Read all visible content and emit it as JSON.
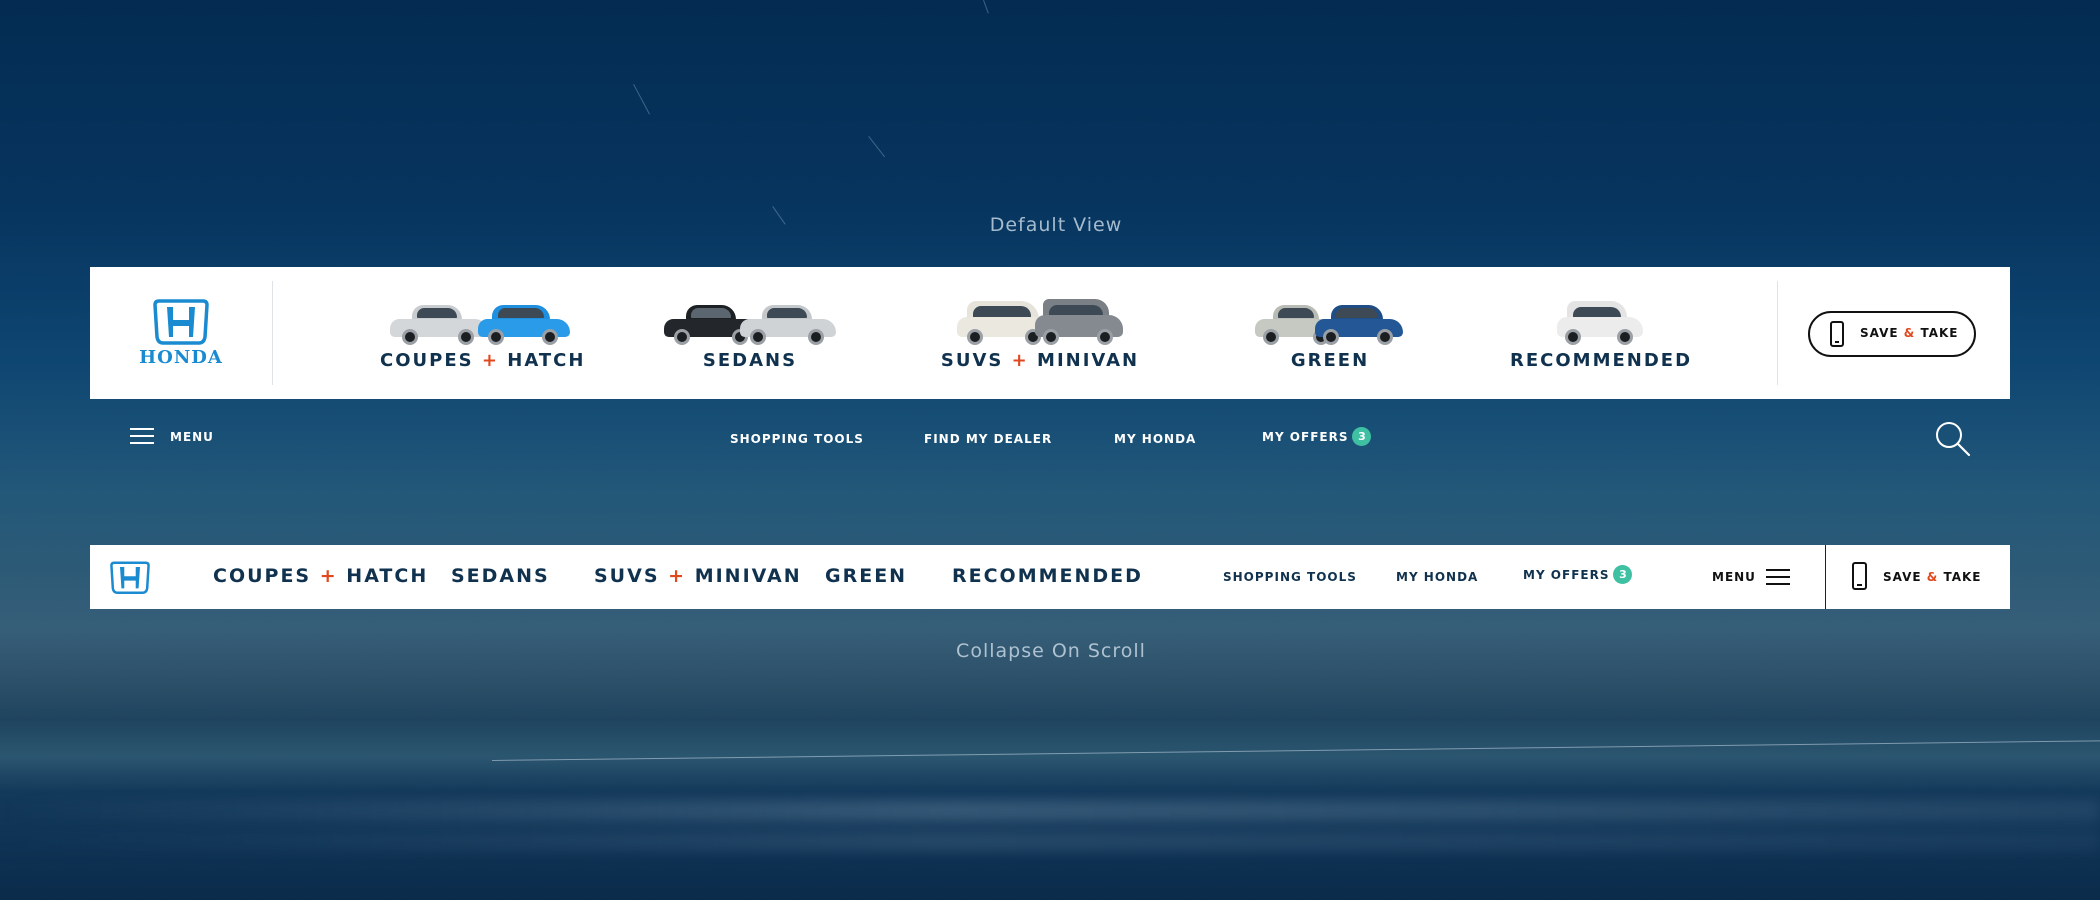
{
  "captions": {
    "default_view": "Default View",
    "collapse_on_scroll": "Collapse On Scroll"
  },
  "brand": {
    "logo_text": "HONDA",
    "logo_icon": "honda-h-icon",
    "logo_color": "#1a8bd0"
  },
  "colors": {
    "navy": "#10324e",
    "accent": "#e0481e",
    "badge": "#3fc0a2"
  },
  "categories": [
    {
      "part1": "COUPES",
      "plus": "+",
      "part2": "HATCH"
    },
    {
      "part1": "SEDANS",
      "plus": "",
      "part2": ""
    },
    {
      "part1": "SUVS",
      "plus": "+",
      "part2": "MINIVAN"
    },
    {
      "part1": "GREEN",
      "plus": "",
      "part2": ""
    },
    {
      "part1": "RECOMMENDED",
      "plus": "",
      "part2": ""
    }
  ],
  "save_take": {
    "save": "SAVE",
    "amp": "&",
    "take": "TAKE",
    "icon": "phone-icon"
  },
  "sub_nav": {
    "menu_label": "MENU",
    "shopping_tools": "SHOPPING TOOLS",
    "find_my_dealer": "FIND MY DEALER",
    "my_honda": "MY HONDA",
    "my_offers": "MY OFFERS",
    "offers_count": "3",
    "search_icon": "search-icon"
  },
  "collapsed": {
    "shopping_tools": "SHOPPING TOOLS",
    "my_honda": "MY HONDA",
    "my_offers": "MY OFFERS",
    "offers_count": "3",
    "menu_label": "MENU"
  }
}
